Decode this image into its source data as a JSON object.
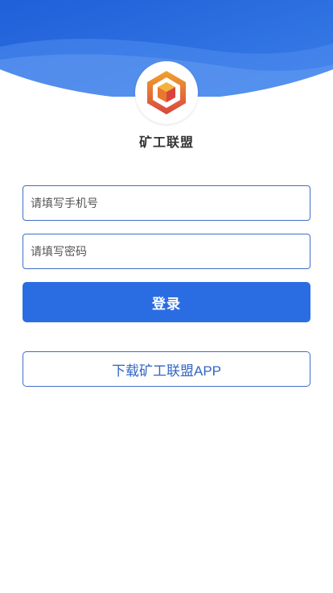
{
  "app": {
    "name": "矿工联盟",
    "logo_icon": "hexagon-cube-logo-icon"
  },
  "form": {
    "phone_placeholder": "请填写手机号",
    "password_placeholder": "请填写密码",
    "login_label": "登录",
    "download_label": "下载矿工联盟APP"
  },
  "colors": {
    "header_blue": "#2a6de3",
    "header_light": "#5b92ee",
    "primary": "#2a6de3",
    "border": "#3f6ec5",
    "logo_orange": "#f0a22e",
    "logo_red": "#d8463f"
  }
}
